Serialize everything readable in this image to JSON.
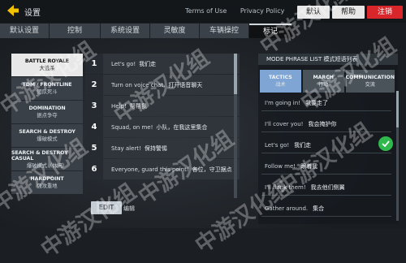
{
  "topbar": {
    "title": "设置",
    "links": [
      "Terms of Use",
      "Privacy Policy"
    ],
    "default_btn": "默认",
    "help_btn": "帮助",
    "logout_btn": "注销"
  },
  "tabs": [
    "默认设置",
    "控制",
    "系统设置",
    "灵敏度",
    "车辆操控",
    "标记"
  ],
  "modes": [
    {
      "en": "BATTLE ROYALE",
      "cn": "大逃杀"
    },
    {
      "en": "TDM / FRONTLINE",
      "cn": "团队死斗"
    },
    {
      "en": "DOMINATION",
      "cn": "据点争夺"
    },
    {
      "en": "SEARCH & DESTROY",
      "cn": "爆破模式"
    },
    {
      "en": "SEARCH & DESTROY CASUAL",
      "cn": "爆破模式（休闲）"
    },
    {
      "en": "HARDPOINT",
      "cn": "强攻重地"
    }
  ],
  "phrases": [
    {
      "num": "1",
      "en": "Let's go!",
      "cn": "我们走"
    },
    {
      "num": "2",
      "en": "Turn on voice chat.",
      "cn": "打开语音聊天"
    },
    {
      "num": "3",
      "en": "Help!",
      "cn": "帮帮我"
    },
    {
      "num": "4",
      "en": "Squad, on me!",
      "cn": "小队，在我这里集合"
    },
    {
      "num": "5",
      "en": "Stay alert!",
      "cn": "保持警惕"
    },
    {
      "num": "6",
      "en": "Everyone, guard this point!",
      "cn": "各位，守卫据点"
    }
  ],
  "edit": {
    "button": "EDIT",
    "label": "编辑"
  },
  "right_panel": {
    "header": "MODE PHRASE LIST  模式短语列表",
    "tabs": [
      {
        "en": "TACTICS",
        "cn": "战术"
      },
      {
        "en": "MARCH",
        "cn": "行动"
      },
      {
        "en": "COMMUNICATION",
        "cn": "交流"
      }
    ],
    "phrases": [
      {
        "en": "I'm going in!",
        "cn": "我要走了"
      },
      {
        "en": "I'll cover you!",
        "cn": "我会掩护你"
      },
      {
        "en": "Let's go!",
        "cn": "我们走"
      },
      {
        "en": "Follow me!",
        "cn": "跟着我"
      },
      {
        "en": "I'll flank them!",
        "cn": "我去他们侧翼"
      },
      {
        "en": "Gather around.",
        "cn": "集合"
      }
    ]
  },
  "watermark": "中游汉化组",
  "colors": {
    "logout": "#d8262b",
    "active_tab_blue": "#7ea5d3",
    "check_green": "#2fb84c",
    "back_arrow": "#f2c200"
  }
}
